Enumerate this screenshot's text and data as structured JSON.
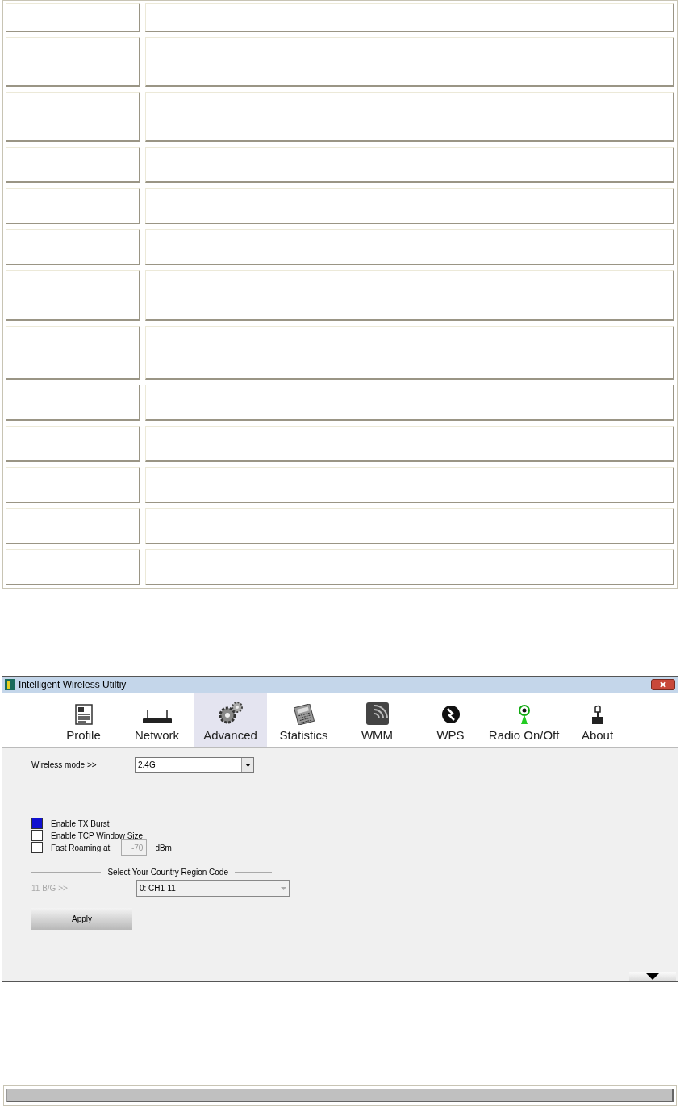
{
  "window": {
    "title": "Intelligent Wireless Utiltiy"
  },
  "toolbar": [
    {
      "label": "Profile",
      "kind": "profile",
      "selected": false
    },
    {
      "label": "Network",
      "kind": "network",
      "selected": false
    },
    {
      "label": "Advanced",
      "kind": "advanced",
      "selected": true
    },
    {
      "label": "Statistics",
      "kind": "statistics",
      "selected": false
    },
    {
      "label": "WMM",
      "kind": "wmm",
      "selected": false
    },
    {
      "label": "WPS",
      "kind": "wps",
      "selected": false
    },
    {
      "label": "Radio On/Off",
      "kind": "radio",
      "selected": false
    },
    {
      "label": "About",
      "kind": "about",
      "selected": false
    }
  ],
  "wireless_mode": {
    "label": "Wireless mode >>",
    "value": "2.4G"
  },
  "options": [
    {
      "label": "Enable TX Burst",
      "checked": true
    },
    {
      "label": "Enable TCP Window Size",
      "checked": false
    },
    {
      "label": "Fast Roaming at",
      "checked": false,
      "value": "-70",
      "unit": "dBm"
    }
  ],
  "region": {
    "title": "Select Your Country Region Code",
    "label": "11 B/G >>",
    "value": "0: CH1-11",
    "disabled": true
  },
  "apply_button": "Apply"
}
